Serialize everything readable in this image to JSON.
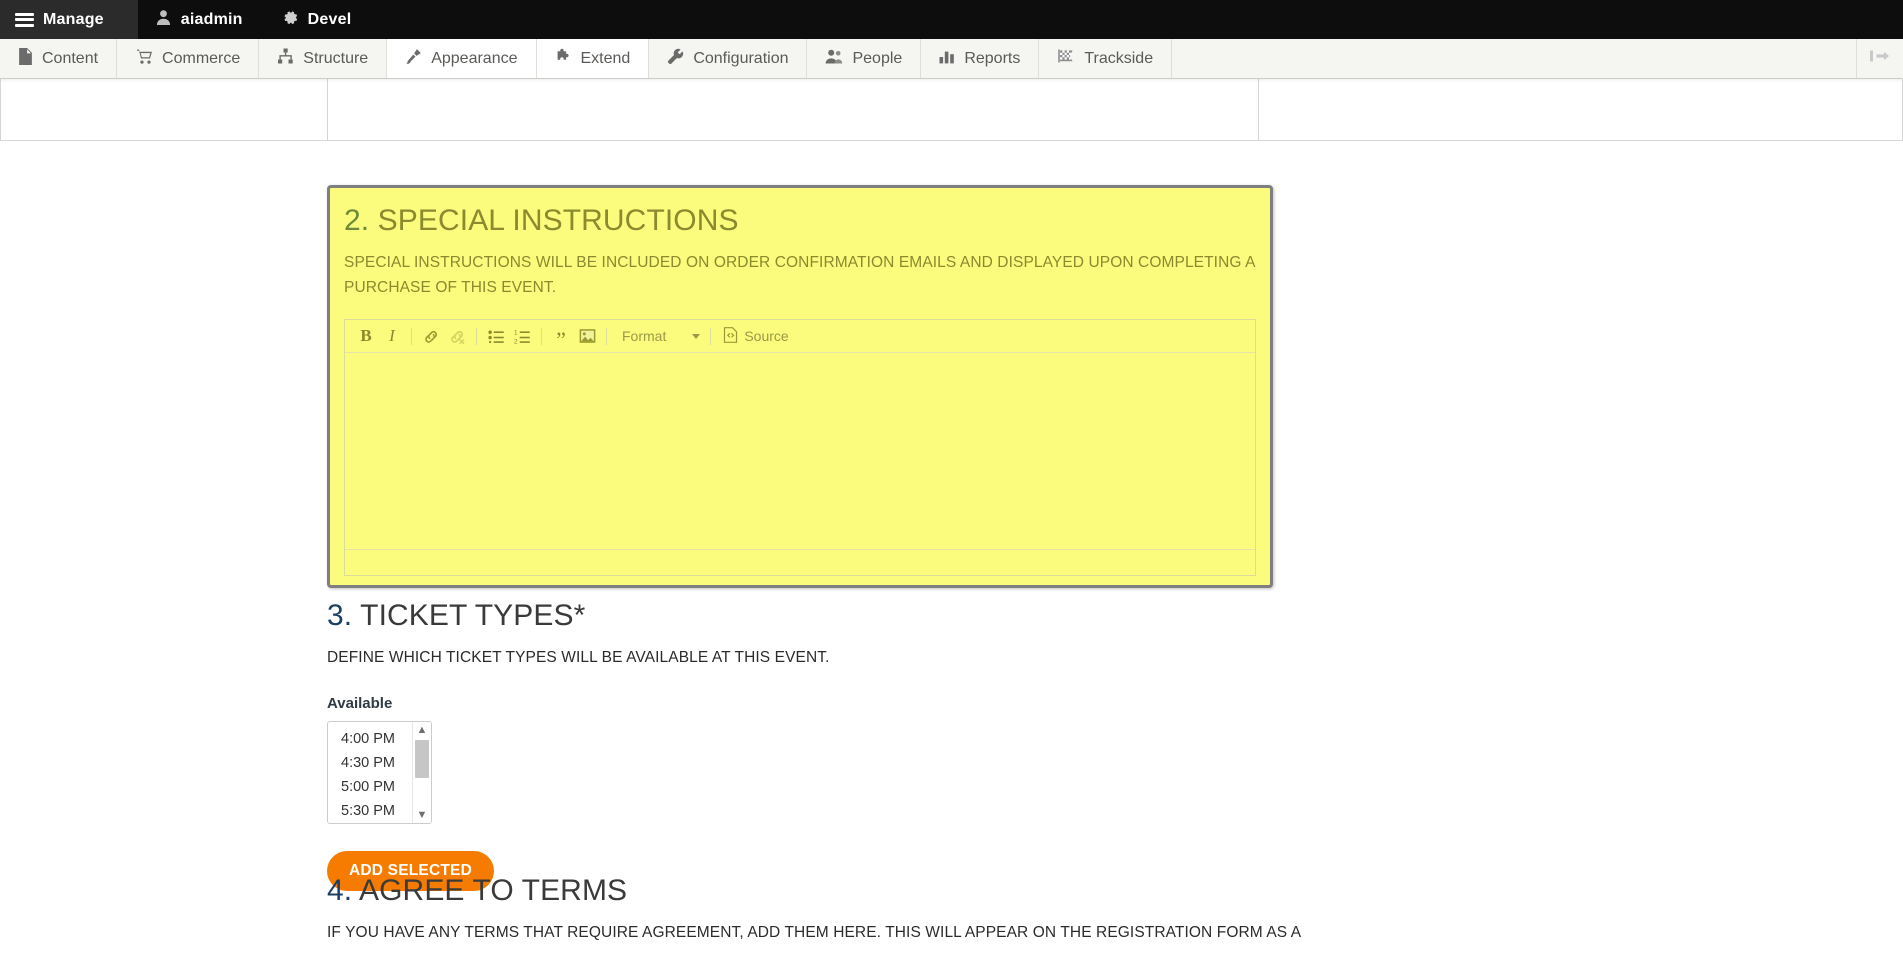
{
  "admin_bar": {
    "items": [
      {
        "label": "Manage",
        "icon": "hamburger-icon"
      },
      {
        "label": "aiadmin",
        "icon": "user-icon"
      },
      {
        "label": "Devel",
        "icon": "gear-icon"
      }
    ]
  },
  "admin_tray": {
    "items": [
      {
        "label": "Content",
        "icon": "file-icon",
        "active": false
      },
      {
        "label": "Commerce",
        "icon": "shopping-cart-icon",
        "active": false
      },
      {
        "label": "Structure",
        "icon": "sitemap-icon",
        "active": false
      },
      {
        "label": "Appearance",
        "icon": "paintbrush-icon",
        "active": true
      },
      {
        "label": "Extend",
        "icon": "puzzle-piece-icon",
        "active": true
      },
      {
        "label": "Configuration",
        "icon": "wrench-icon",
        "active": false
      },
      {
        "label": "People",
        "icon": "people-icon",
        "active": false
      },
      {
        "label": "Reports",
        "icon": "bar-chart-icon",
        "active": false
      },
      {
        "label": "Trackside",
        "icon": "checkered-flag-icon",
        "active": false
      }
    ],
    "orientation_toggle": "orientation-toggle-icon"
  },
  "sections": {
    "special_instructions": {
      "number": "2.",
      "title": "SPECIAL INSTRUCTIONS",
      "description": "SPECIAL INSTRUCTIONS WILL BE INCLUDED ON ORDER CONFIRMATION EMAILS AND DISPLAYED UPON COMPLETING A PURCHASE OF THIS EVENT.",
      "highlight_color": "#fbfb7d",
      "border_color": "#7f7f7f",
      "text_color": "#8a8a2e",
      "number_color": "#6f8a3a",
      "editor": {
        "toolbar": [
          {
            "name": "bold-icon",
            "label": "B"
          },
          {
            "name": "italic-icon",
            "label": "I"
          },
          {
            "name": "link-icon",
            "label": "link"
          },
          {
            "name": "unlink-icon",
            "label": "unlink"
          },
          {
            "name": "bulleted-list-icon",
            "label": "bulleted list"
          },
          {
            "name": "numbered-list-icon",
            "label": "numbered list"
          },
          {
            "name": "blockquote-icon",
            "label": "blockquote"
          },
          {
            "name": "image-icon",
            "label": "image"
          }
        ],
        "format_label": "Format",
        "source_label": "Source",
        "body_value": ""
      }
    },
    "ticket_types": {
      "number": "3.",
      "title": "TICKET TYPES*",
      "description": "DEFINE WHICH TICKET TYPES WILL BE AVAILABLE AT THIS EVENT.",
      "number_color": "#1c3f66",
      "available_label": "Available",
      "options": [
        "4:00 PM",
        "4:30 PM",
        "5:00 PM",
        "5:30 PM"
      ],
      "add_button_label": "ADD SELECTED",
      "add_button_color": "#f57c00"
    },
    "agree_to_terms": {
      "number": "4.",
      "title": "AGREE TO TERMS",
      "description": "IF YOU HAVE ANY TERMS THAT REQUIRE AGREEMENT, ADD THEM HERE. THIS WILL APPEAR ON THE REGISTRATION FORM AS A",
      "number_color": "#1c3f66"
    }
  }
}
